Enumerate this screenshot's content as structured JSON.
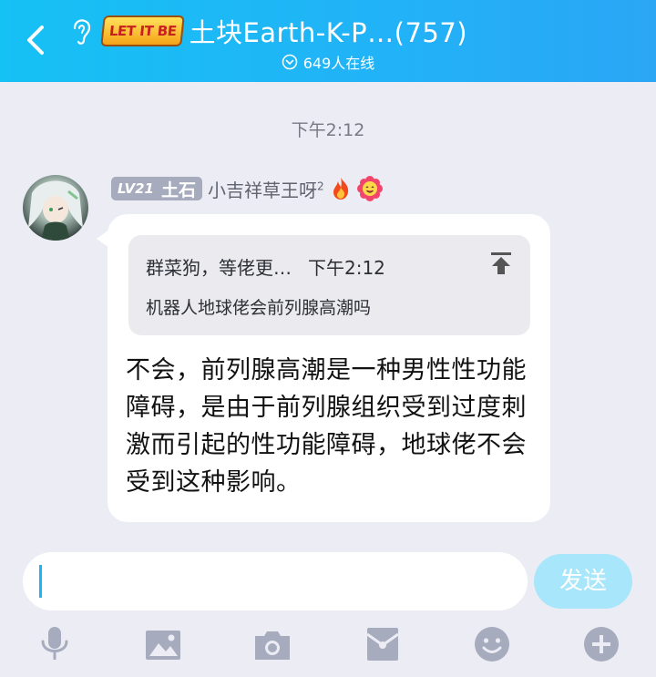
{
  "header": {
    "badge_text": "LET IT BE",
    "title": "土块Earth-K-P…(757)",
    "online": "649人在线"
  },
  "chat": {
    "time": "下午2:12",
    "message": {
      "level": "LV21",
      "rank": "土石",
      "sender": "小吉祥草王呀",
      "sender_sup": "2",
      "quote": {
        "author": "群菜狗，等佬更…",
        "time": "下午2:12",
        "text": "机器人地球佬会前列腺高潮吗"
      },
      "text": "不会，前列腺高潮是一种男性性功能障碍，是由于前列腺组织受到过度刺激而引起的性功能障碍，地球佬不会受到这种影响。"
    }
  },
  "input": {
    "value": "",
    "send_label": "发送"
  },
  "toolbar": {
    "items": [
      "mic-icon",
      "image-icon",
      "camera-icon",
      "red-packet-icon",
      "emoji-icon",
      "plus-icon"
    ]
  },
  "colors": {
    "header": "#1fb8f5",
    "accent": "#16b7f2",
    "send_inactive": "#a7e6fb",
    "background": "#ececf4"
  }
}
